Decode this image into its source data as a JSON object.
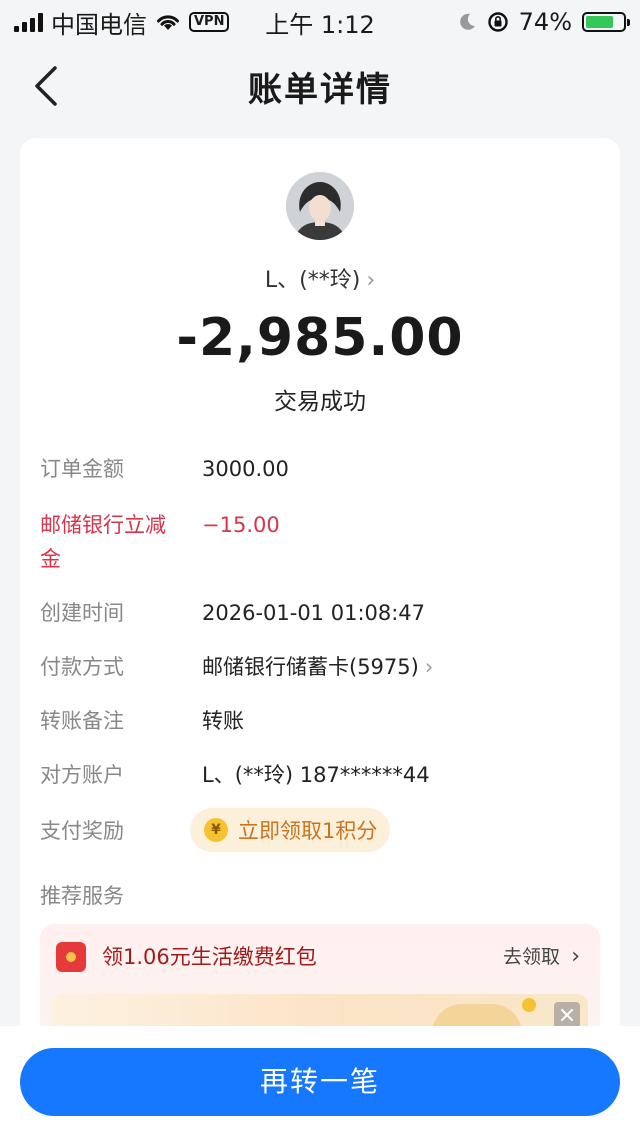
{
  "status_bar": {
    "carrier": "中国电信",
    "vpn": "VPN",
    "time": "上午 1:12",
    "battery": "74%",
    "battery_level": 0.74
  },
  "nav": {
    "title": "账单详情",
    "back_icon": "chevron-left-icon"
  },
  "summary": {
    "payee": "L、(**玲)",
    "amount": "-2,985.00",
    "status": "交易成功"
  },
  "details": [
    {
      "label": "订单金额",
      "value": "3000.00"
    },
    {
      "label_line1": "邮储银行立减",
      "label_line2": "金",
      "value": "−15.00"
    },
    {
      "label": "创建时间",
      "value": "2026-01-01 01:08:47"
    },
    {
      "label": "付款方式",
      "value": "邮储银行储蓄卡(5975)"
    },
    {
      "label": "转账备注",
      "value": "转账"
    },
    {
      "label": "对方账户",
      "value": "L、(**玲) 187******44"
    },
    {
      "label": "支付奖励",
      "value": "立即领取1积分"
    }
  ],
  "services": {
    "title": "推荐服务",
    "promo_text": "领1.06元生活缴费红包",
    "promo_link": "去领取"
  },
  "colors": {
    "primary": "#1677ff",
    "discount_red": "#d9344a",
    "reward_orange": "#c8751f"
  },
  "footer": {
    "button": "再转一笔"
  }
}
